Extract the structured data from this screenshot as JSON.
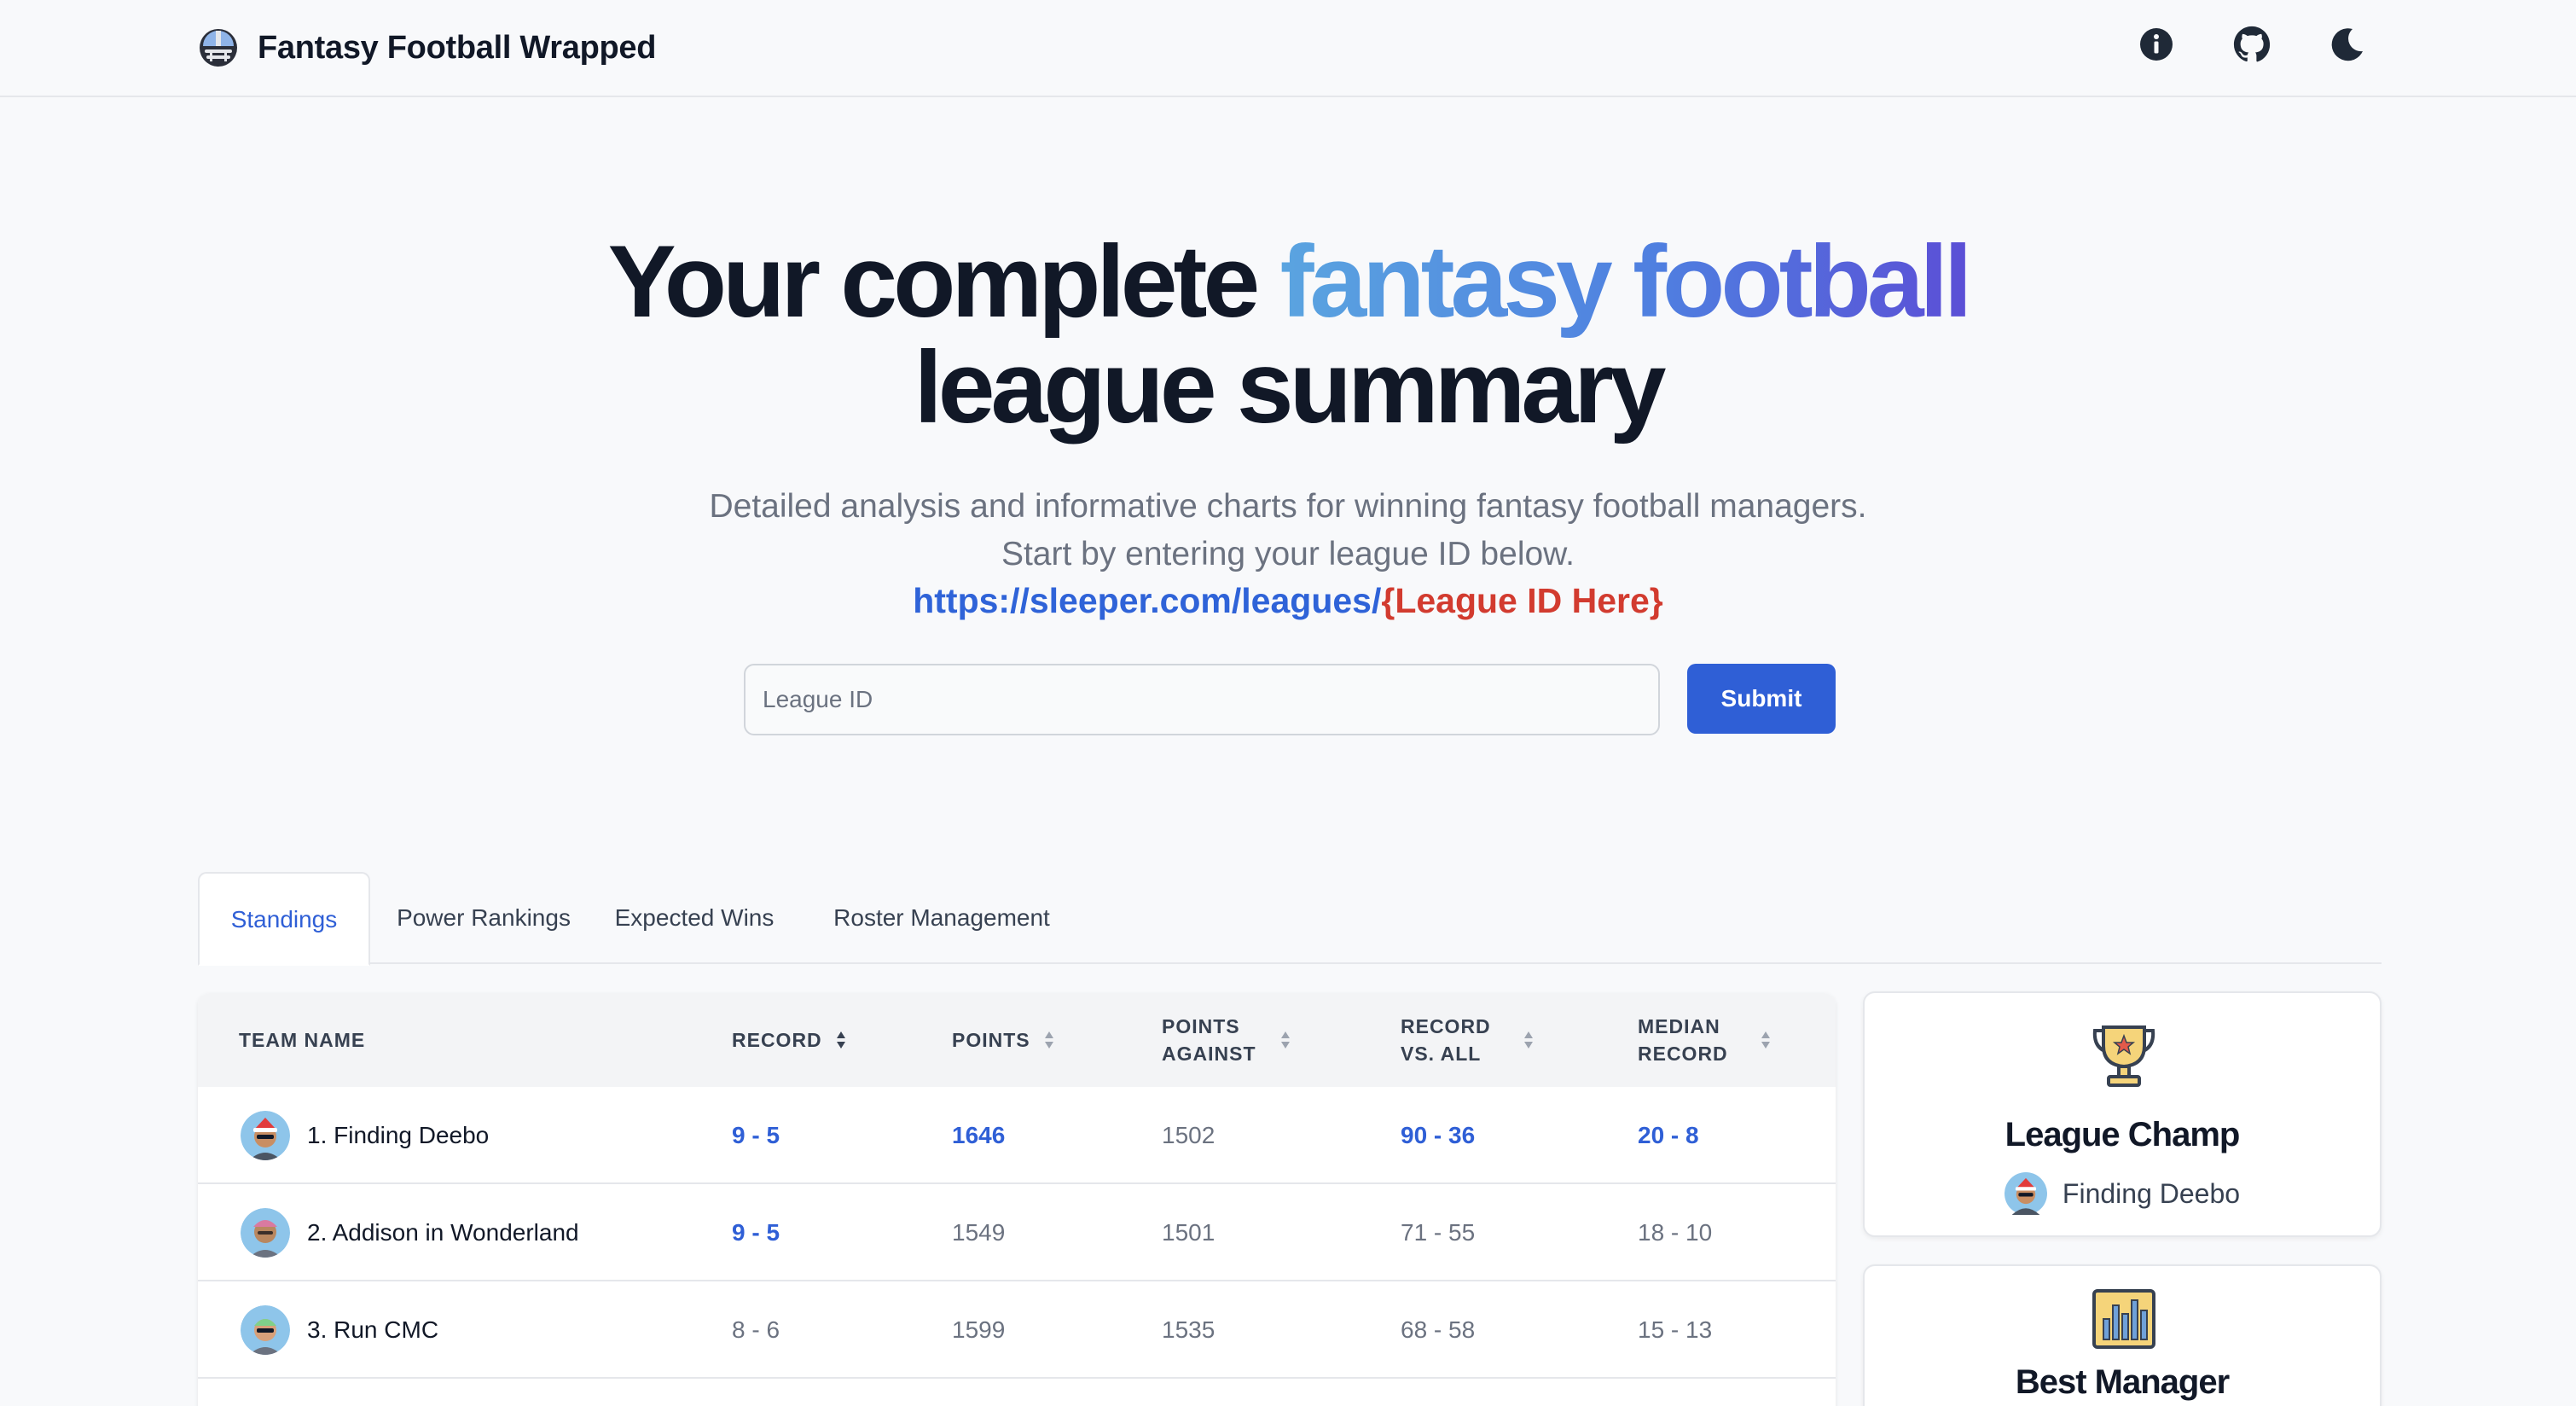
{
  "app": {
    "title": "Fantasy Football Wrapped"
  },
  "hero": {
    "title_part1": "Your complete ",
    "title_highlight": "fantasy football",
    "title_part2": "league summary",
    "subtitle_line1": "Detailed analysis and informative charts for winning fantasy football managers.",
    "subtitle_line2": "Start by entering your league ID below.",
    "url_base": "https://sleeper.com/leagues/",
    "url_placeholder": "{League ID Here}"
  },
  "form": {
    "input_placeholder": "League ID",
    "input_value": "",
    "submit_label": "Submit"
  },
  "tabs": [
    {
      "label": "Standings",
      "active": true
    },
    {
      "label": "Power Rankings",
      "active": false
    },
    {
      "label": "Expected Wins",
      "active": false
    },
    {
      "label": "Roster Management",
      "active": false
    }
  ],
  "table": {
    "headers": {
      "team": "TEAM NAME",
      "record": "RECORD",
      "points": "POINTS",
      "points_against_1": "POINTS",
      "points_against_2": "AGAINST",
      "vs_all_1": "RECORD",
      "vs_all_2": "VS. ALL",
      "median_1": "MEDIAN",
      "median_2": "RECORD"
    },
    "rows": [
      {
        "team": "1. Finding Deebo",
        "record": "9 - 5",
        "points": "1646",
        "points_against": "1502",
        "vs_all": "90 - 36",
        "median": "20 - 8"
      },
      {
        "team": "2. Addison in Wonderland",
        "record": "9 - 5",
        "points": "1549",
        "points_against": "1501",
        "vs_all": "71 - 55",
        "median": "18 - 10"
      },
      {
        "team": "3. Run CMC",
        "record": "8 - 6",
        "points": "1599",
        "points_against": "1535",
        "vs_all": "68 - 58",
        "median": "15 - 13"
      }
    ]
  },
  "awards": {
    "champ": {
      "title": "League Champ",
      "winner": "Finding Deebo"
    },
    "best_manager": {
      "title": "Best Manager"
    }
  },
  "colors": {
    "accent": "#2f5fd6",
    "url_red": "#d23b2f",
    "gradient_start": "#5aa4e0",
    "gradient_end": "#5b4fd6"
  },
  "icons": [
    "football-helmet-logo",
    "info-icon",
    "github-icon",
    "moon-icon",
    "sort-icon",
    "trophy-icon",
    "bar-chart-icon"
  ]
}
